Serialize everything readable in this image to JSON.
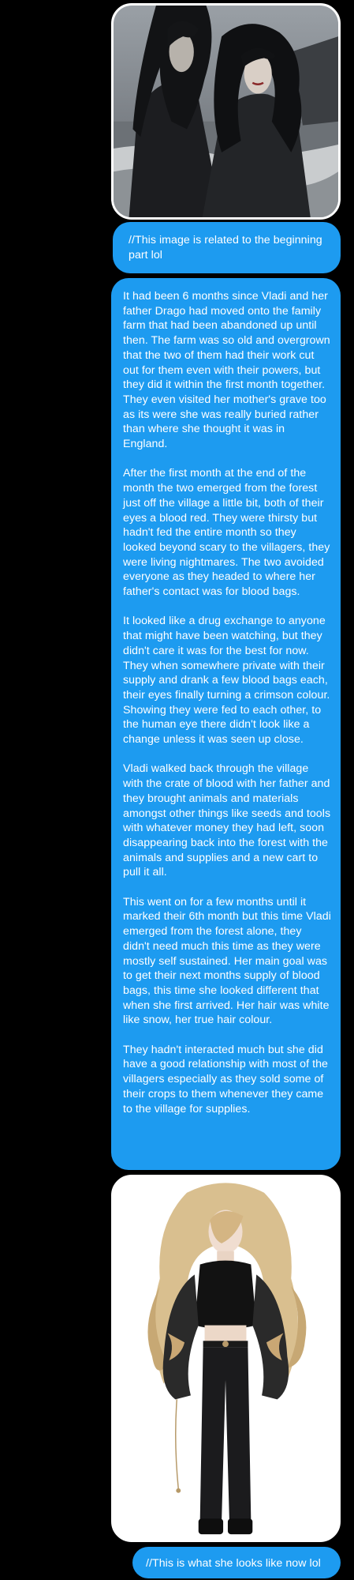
{
  "messages": {
    "image_1": {
      "alt": "Two dark-haired figures on a beach",
      "icon": "photo-attachment"
    },
    "caption_1": "//This image is related to the beginning part lol",
    "story_paragraphs": [
      "It had been 6 months since Vladi and her father Drago had moved onto the family farm that had been abandoned up until then. The farm was so old and overgrown that the two of them had their work cut out for them even with their powers, but they did it within the first month together. They even visited her mother's grave too as its were she was really buried rather than where she thought it was in England.",
      "After the first month at the end of the month the two emerged from the forest just off the village a little bit, both of their eyes a blood red. They were thirsty but hadn't fed the entire month so they looked beyond scary to the villagers, they were living nightmares. The two avoided everyone as they headed to where her father's contact was for blood bags.",
      "It looked like a drug exchange to anyone that might have been watching, but they didn't care it was for the best for now. They when somewhere private with their supply and drank a few blood bags each, their eyes finally turning a crimson colour. Showing they were fed to each other, to the human eye there didn't look like a change unless it was seen up close.",
      "Vladi walked back through the village with the crate of blood with her father and they brought animals and materials amongst other things like seeds and tools with whatever money they had left, soon disappearing back into the forest with the animals and supplies and a new cart to pull it all.",
      "This went on for a few months until it marked their 6th month but this time Vladi emerged from the forest alone, they didn't need much this time as they were mostly self sustained. Her main goal was to get their next months supply of blood bags, this time she looked different that when she first arrived. Her hair was white like snow, her true hair colour.",
      "They hadn't interacted much but she did have a good relationship with most of the villagers especially as they sold some of their crops to them whenever they came to the village for supplies."
    ],
    "image_2": {
      "alt": "Woman with long wavy blonde hair in black outfit",
      "icon": "photo-attachment"
    },
    "caption_2": "//This is what she looks like now lol"
  },
  "colors": {
    "background": "#000000",
    "bubble": "#1d9bf0",
    "bubble_text": "#ffffff"
  }
}
